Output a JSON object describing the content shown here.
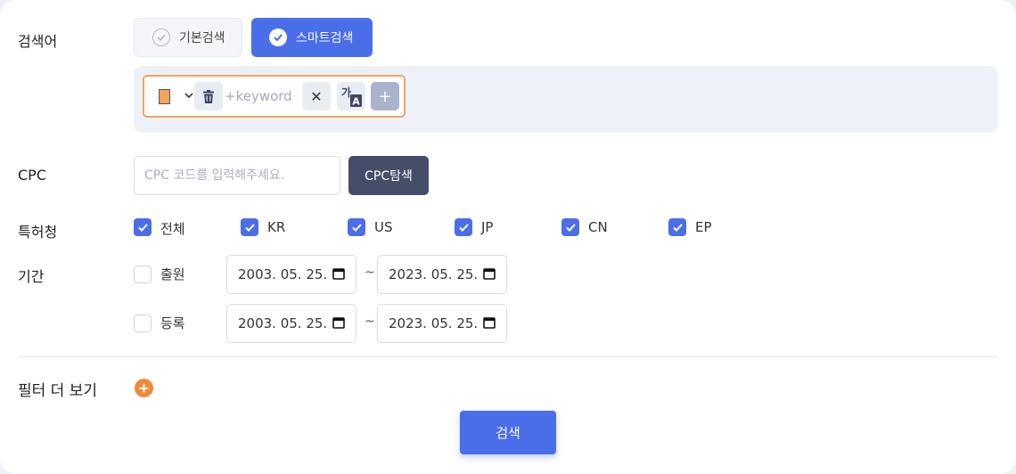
{
  "labels": {
    "keyword": "검색어",
    "cpc": "CPC",
    "office": "특허청",
    "period": "기간",
    "more_filters": "필터 더 보기"
  },
  "mode": {
    "basic": "기본검색",
    "smart": "스마트검색",
    "selected": "smart"
  },
  "keyword_row": {
    "color": "#f3a35a",
    "placeholder": "+keyword",
    "clear_glyph": "✕",
    "translate_top": "가",
    "translate_bottom": "A",
    "add_glyph": "+"
  },
  "cpc": {
    "placeholder": "CPC 코드를 입력해주세요.",
    "button": "CPC탐색"
  },
  "offices": [
    {
      "label": "전체",
      "checked": true
    },
    {
      "label": "KR",
      "checked": true
    },
    {
      "label": "US",
      "checked": true
    },
    {
      "label": "JP",
      "checked": true
    },
    {
      "label": "CN",
      "checked": true
    },
    {
      "label": "EP",
      "checked": true
    }
  ],
  "period": {
    "filing": {
      "label": "출원",
      "checked": false,
      "from": "2003. 05. 25.",
      "to": "2023. 05. 25."
    },
    "registration": {
      "label": "등록",
      "checked": false,
      "from": "2003. 05. 25.",
      "to": "2023. 05. 25."
    },
    "separator": "~"
  },
  "more_filters_glyph": "+",
  "search_button": "검색",
  "colors": {
    "primary": "#4a6ee9",
    "dark_button": "#464d69",
    "accent_orange": "#f08a37"
  }
}
